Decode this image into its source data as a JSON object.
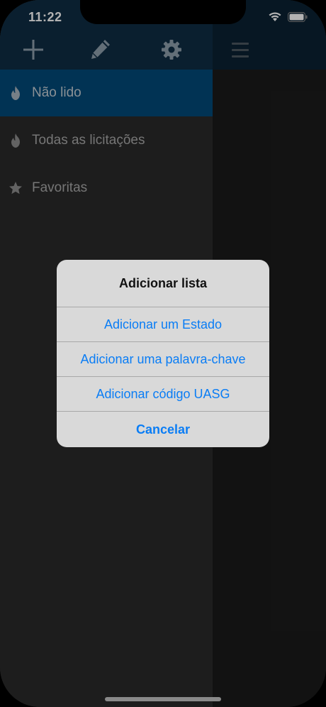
{
  "status_bar": {
    "time": "11:22"
  },
  "sidebar": {
    "toolbar": {
      "add_icon": "plus-icon",
      "edit_icon": "pencil-icon",
      "settings_icon": "gear-icon"
    },
    "items": [
      {
        "label": "Não lido",
        "icon": "flame-icon",
        "active": true
      },
      {
        "label": "Todas as licitações",
        "icon": "flame-icon",
        "active": false
      },
      {
        "label": "Favoritas",
        "icon": "star-icon",
        "active": false
      }
    ]
  },
  "main": {
    "menu_icon": "hamburger-icon"
  },
  "alert": {
    "title": "Adicionar lista",
    "buttons": [
      "Adicionar um Estado",
      "Adicionar uma palavra-chave",
      "Adicionar código UASG",
      "Cancelar"
    ]
  },
  "colors": {
    "header": "#0f2d44",
    "active_item": "#024a79",
    "alert_button_text": "#0a7df5"
  }
}
